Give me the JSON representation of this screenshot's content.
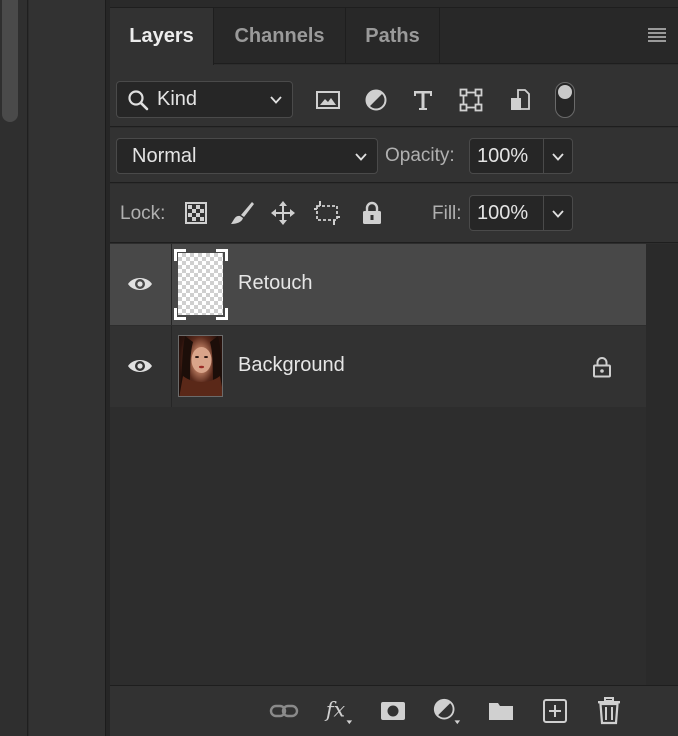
{
  "tabs": [
    {
      "label": "Layers",
      "active": true
    },
    {
      "label": "Channels",
      "active": false
    },
    {
      "label": "Paths",
      "active": false
    }
  ],
  "filter": {
    "kind_label": "Kind",
    "icons": [
      "image-filter-icon",
      "adjustment-filter-icon",
      "type-filter-icon",
      "shape-filter-icon",
      "smart-object-filter-icon"
    ]
  },
  "blend": {
    "mode": "Normal",
    "opacity_label": "Opacity:",
    "opacity_value": "100%"
  },
  "lock": {
    "label": "Lock:",
    "fill_label": "Fill:",
    "fill_value": "100%"
  },
  "layers": [
    {
      "name": "Retouch",
      "visible": true,
      "selected": true,
      "locked": false
    },
    {
      "name": "Background",
      "visible": true,
      "selected": false,
      "locked": true
    }
  ],
  "footer_icons": [
    "link-layers-icon",
    "fx-icon",
    "add-mask-icon",
    "adjustment-layer-icon",
    "new-group-icon",
    "new-layer-icon",
    "delete-icon"
  ],
  "colors": {
    "panel_bg": "#2d2d2d",
    "selected_row": "#484848",
    "active_tab_text": "#ececec"
  }
}
